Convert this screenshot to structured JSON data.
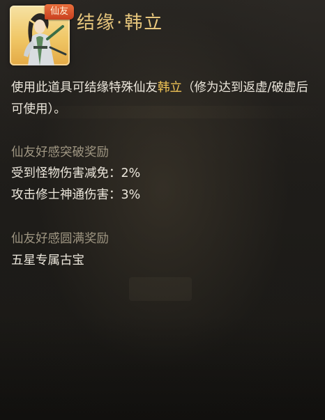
{
  "item": {
    "tag": "仙友",
    "title_prefix": "结缘",
    "title_sep": "·",
    "title_name": "韩立"
  },
  "description": {
    "part1": "使用此道具可结缘特殊仙友",
    "highlight": "韩立",
    "part2": "（修为达到返虚/破虚后可使用）。"
  },
  "breakthrough_reward": {
    "heading": "仙友好感突破奖励",
    "lines": [
      "受到怪物伤害减免：2%",
      "攻击修士神通伤害：3%"
    ]
  },
  "full_reward": {
    "heading": "仙友好感圆满奖励",
    "lines": [
      "五星专属古宝"
    ]
  },
  "colors": {
    "title": "#e8c77d",
    "highlight": "#f0c456",
    "heading": "#9f9682",
    "body_text": "#ece7dc",
    "tag_bg": "#d9502a"
  },
  "icons": {
    "item_icon": "cultivator-portrait-icon"
  }
}
